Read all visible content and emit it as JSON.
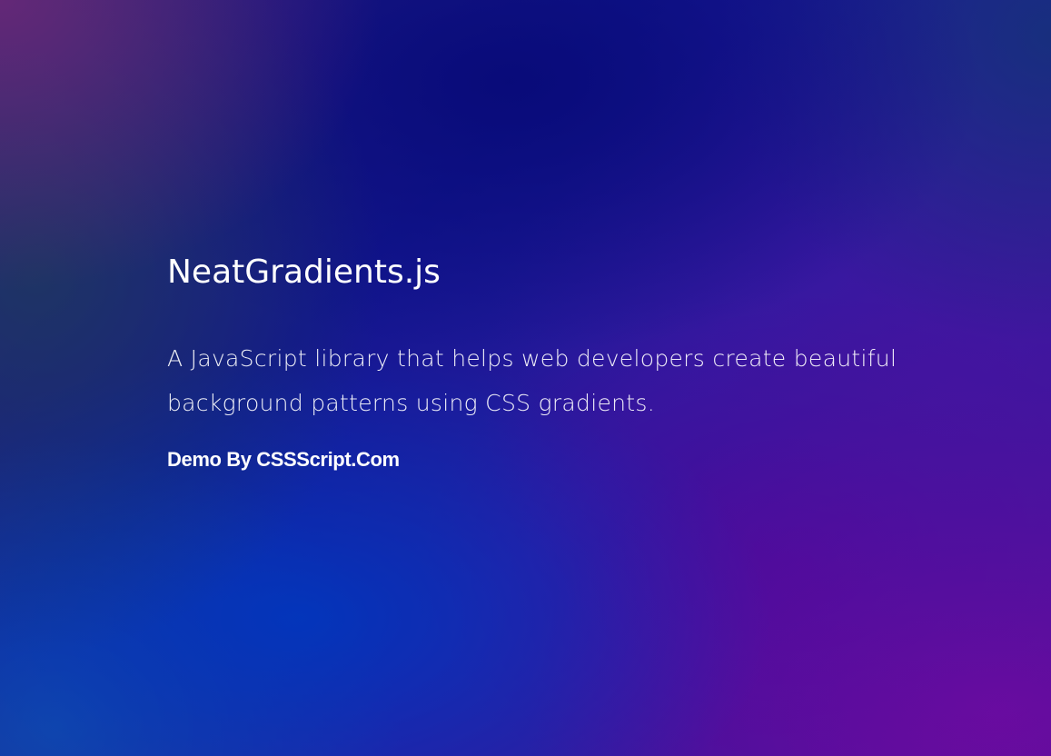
{
  "page": {
    "title": "NeatGradients.js",
    "description": "A JavaScript library that helps web developers create beautiful background patterns using CSS gradients.",
    "credit": "Demo By CSSScript.Com"
  },
  "colors": {
    "text": "#ffffff",
    "gradient_stops": [
      "#2a2378",
      "#12168f",
      "#2b1ba0",
      "#4a1298",
      "#0037be",
      "#6e0aa0"
    ]
  }
}
